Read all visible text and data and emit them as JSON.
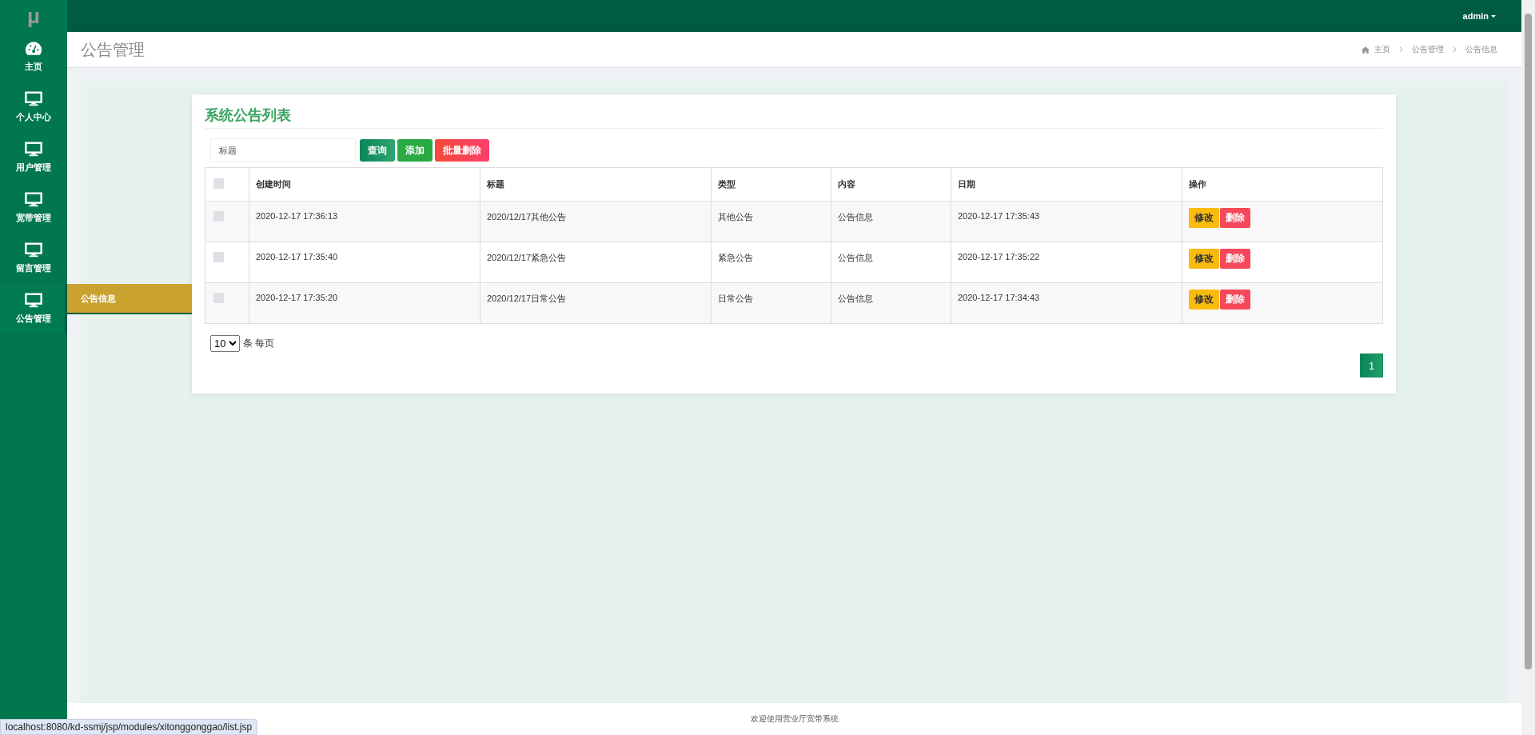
{
  "logo": "μ",
  "user_menu": {
    "label": "admin"
  },
  "sidebar": {
    "items": [
      {
        "label": "主页",
        "kind": "dashboard",
        "selected": false
      },
      {
        "label": "个人中心",
        "kind": "monitor",
        "selected": false
      },
      {
        "label": "用户管理",
        "kind": "monitor",
        "selected": false
      },
      {
        "label": "宽带管理",
        "kind": "monitor",
        "selected": false
      },
      {
        "label": "留言管理",
        "kind": "monitor",
        "selected": false
      },
      {
        "label": "公告管理",
        "kind": "monitor",
        "selected": true
      }
    ]
  },
  "submenu": {
    "items": [
      {
        "label": "公告信息",
        "selected": true
      }
    ]
  },
  "page_header": {
    "title": "公告管理",
    "breadcrumb": [
      "主页",
      "公告管理",
      "公告信息"
    ]
  },
  "card": {
    "title": "系统公告列表",
    "search": {
      "placeholder": "标题"
    },
    "buttons": [
      {
        "label": "查询",
        "kind": "search"
      },
      {
        "label": "添加",
        "kind": "add"
      },
      {
        "label": "批量删除",
        "kind": "delete"
      }
    ],
    "table": {
      "select_all_checked": false,
      "columns": [
        "创建时间",
        "标题",
        "类型",
        "内容",
        "日期",
        "操作"
      ],
      "rows": [
        {
          "checked": false,
          "cells": [
            "2020-12-17 17:36:13",
            "2020/12/17其他公告",
            "其他公告",
            "公告信息",
            "2020-12-17 17:35:43"
          ],
          "actions": [
            {
              "label": "修改",
              "kind": "edit"
            },
            {
              "label": "删除",
              "kind": "delete"
            }
          ]
        },
        {
          "checked": false,
          "cells": [
            "2020-12-17 17:35:40",
            "2020/12/17紧急公告",
            "紧急公告",
            "公告信息",
            "2020-12-17 17:35:22"
          ],
          "actions": [
            {
              "label": "修改",
              "kind": "edit"
            },
            {
              "label": "删除",
              "kind": "delete"
            }
          ]
        },
        {
          "checked": false,
          "cells": [
            "2020-12-17 17:35:20",
            "2020/12/17日常公告",
            "日常公告",
            "公告信息",
            "2020-12-17 17:34:43"
          ],
          "actions": [
            {
              "label": "修改",
              "kind": "edit"
            },
            {
              "label": "删除",
              "kind": "delete"
            }
          ]
        }
      ]
    },
    "page_size": "10",
    "page_size_label": "条 每页",
    "pages": [
      {
        "label": "1",
        "selected": true
      }
    ]
  },
  "footer": "欢迎使用营业厅宽带系统",
  "status_bar": "localhost:8080/kd-ssmj/jsp/modules/xitonggonggao/list.jsp"
}
